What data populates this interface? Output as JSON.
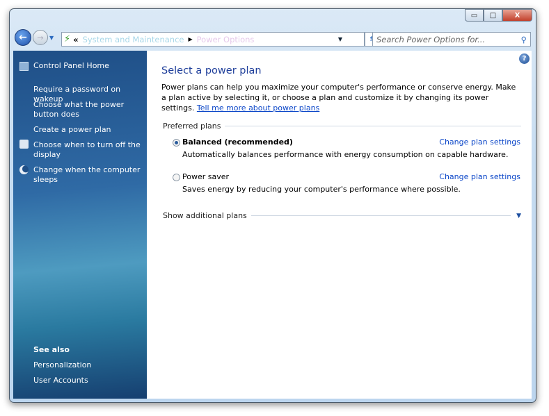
{
  "window": {
    "minimize": "▭",
    "maximize": "□",
    "close": "X"
  },
  "address": {
    "chevrons": "«",
    "crumbs": [
      "System and Maintenance",
      "Power Options"
    ],
    "separator": "▶"
  },
  "search": {
    "placeholder": "Search Power Options for..."
  },
  "sidebar": {
    "home": "Control Panel Home",
    "tasks": [
      "Require a password on wakeup",
      "Choose what the power button does",
      "Create a power plan",
      "Choose when to turn off the display",
      "Change when the computer sleeps"
    ],
    "see_also": "See also",
    "links": [
      "Personalization",
      "User Accounts"
    ]
  },
  "main": {
    "title": "Select a power plan",
    "description": "Power plans can help you maximize your computer's performance or conserve energy. Make a plan active by selecting it, or choose a plan and customize it by changing its power settings.",
    "learn_link": "Tell me more about power plans",
    "preferred": "Preferred plans",
    "plans": [
      {
        "name": "Balanced (recommended)",
        "desc": "Automatically balances performance with energy consumption on capable hardware.",
        "link": "Change plan settings",
        "selected": true
      },
      {
        "name": "Power saver",
        "desc": "Saves energy by reducing your computer's performance where possible.",
        "link": "Change plan settings",
        "selected": false
      }
    ],
    "additional": "Show additional plans"
  }
}
